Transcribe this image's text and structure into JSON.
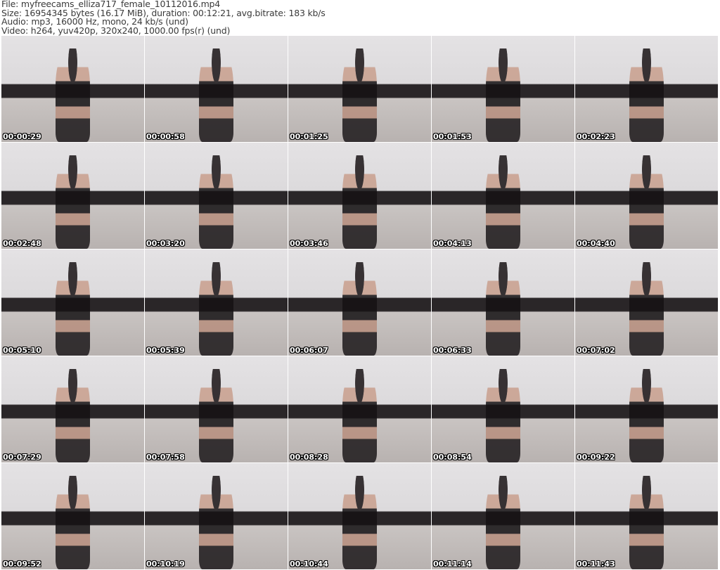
{
  "header": {
    "file": "File: myfreecams_elliza717_female_10112016.mp4",
    "size": "Size: 16954345 bytes (16.17 MiB), duration: 00:12:21, avg.bitrate: 183 kb/s",
    "audio": "Audio: mp3, 16000 Hz, mono, 24 kb/s (und)",
    "video": "Video: h264, yuv420p, 320x240, 1000.00 fps(r) (und)"
  },
  "thumbnails": [
    "00:00:29",
    "00:00:58",
    "00:01:25",
    "00:01:53",
    "00:02:23",
    "00:02:48",
    "00:03:20",
    "00:03:46",
    "00:04:13",
    "00:04:40",
    "00:05:10",
    "00:05:39",
    "00:06:07",
    "00:06:33",
    "00:07:02",
    "00:07:29",
    "00:07:58",
    "00:08:28",
    "00:08:54",
    "00:09:22",
    "00:09:52",
    "00:10:19",
    "00:10:44",
    "00:11:14",
    "00:11:43"
  ]
}
